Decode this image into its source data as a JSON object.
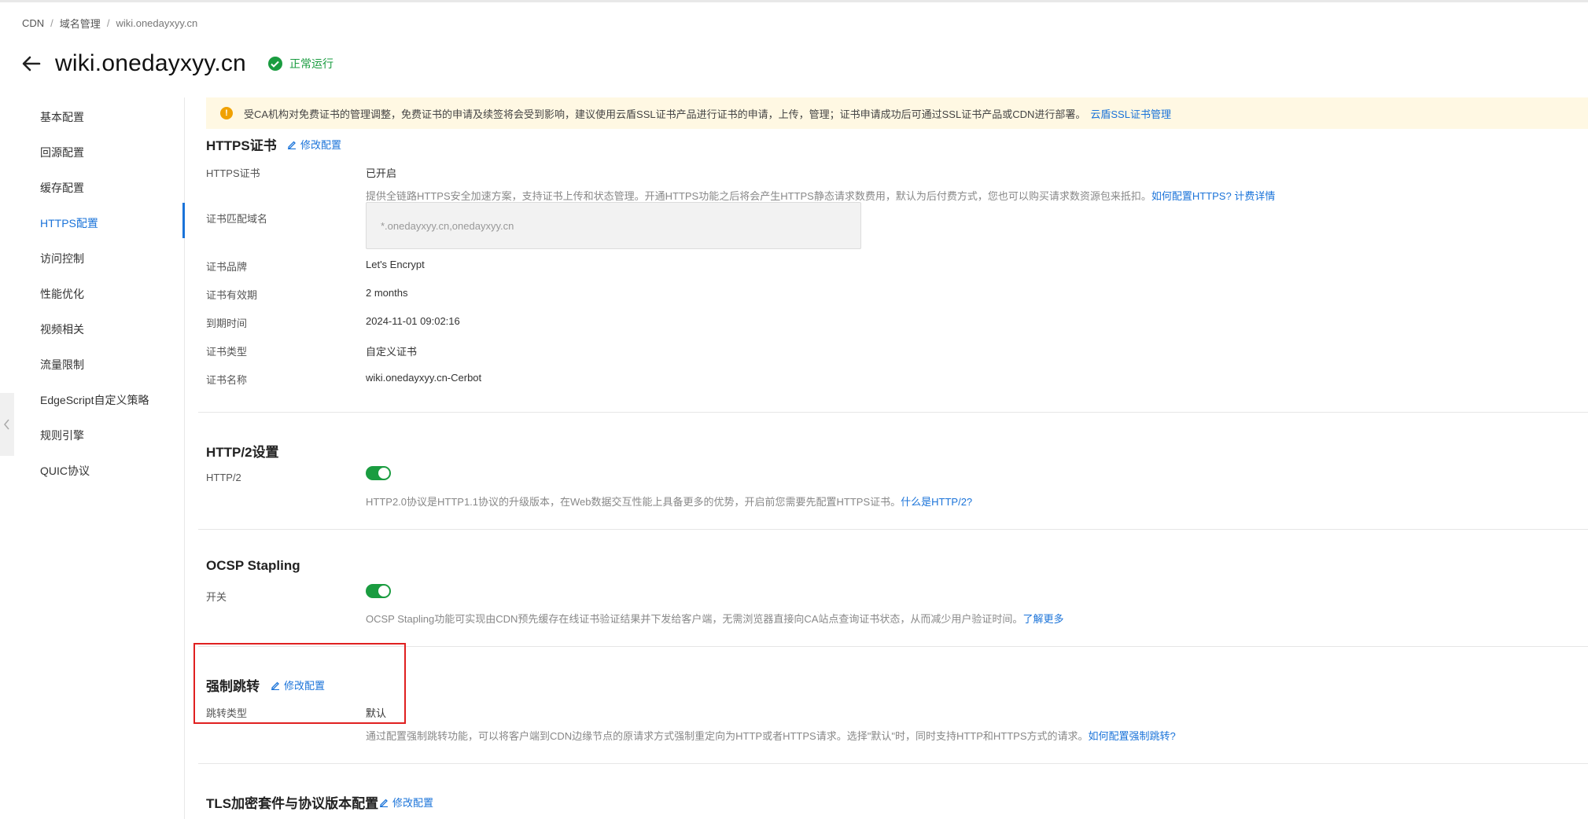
{
  "breadcrumb": {
    "items": [
      "CDN",
      "域名管理",
      "wiki.onedayxyy.cn"
    ],
    "separator": "/"
  },
  "header": {
    "title": "wiki.onedayxyy.cn",
    "status": "正常运行"
  },
  "sidebar": {
    "items": [
      {
        "label": "基本配置"
      },
      {
        "label": "回源配置"
      },
      {
        "label": "缓存配置"
      },
      {
        "label": "HTTPS配置"
      },
      {
        "label": "访问控制"
      },
      {
        "label": "性能优化"
      },
      {
        "label": "视频相关"
      },
      {
        "label": "流量限制"
      },
      {
        "label": "EdgeScript自定义策略"
      },
      {
        "label": "规则引擎"
      },
      {
        "label": "QUIC协议"
      }
    ],
    "active": "HTTPS配置"
  },
  "notice": {
    "text": "受CA机构对免费证书的管理调整，免费证书的申请及续签将会受到影响，建议使用云盾SSL证书产品进行证书的申请，上传，管理；证书申请成功后可通过SSL证书产品或CDN进行部署。",
    "link": "云盾SSL证书管理"
  },
  "https_section": {
    "title": "HTTPS证书",
    "edit_label": "修改配置",
    "cert_label": "HTTPS证书",
    "cert_value": "已开启",
    "cert_desc": "提供全链路HTTPS安全加速方案，支持证书上传和状态管理。开通HTTPS功能之后将会产生HTTPS静态请求数费用，默认为后付费方式，您也可以购买请求数资源包来抵扣。",
    "cert_link_1": "如何配置HTTPS?",
    "cert_link_2": "计费详情",
    "domain_label": "证书匹配域名",
    "domain_value": "*.onedayxyy.cn,onedayxyy.cn",
    "brand_label": "证书品牌",
    "brand_value": "Let's Encrypt",
    "validity_label": "证书有效期",
    "validity_value": "2 months",
    "expire_label": "到期时间",
    "expire_value": "2024-11-01 09:02:16",
    "type_label": "证书类型",
    "type_value": "自定义证书",
    "name_label": "证书名称",
    "name_value": "wiki.onedayxyy.cn-Cerbot"
  },
  "http2_section": {
    "title": "HTTP/2设置",
    "label": "HTTP/2",
    "enabled": true,
    "desc": "HTTP2.0协议是HTTP1.1协议的升级版本，在Web数据交互性能上具备更多的优势，开启前您需要先配置HTTPS证书。",
    "link": "什么是HTTP/2?"
  },
  "ocsp_section": {
    "title": "OCSP Stapling",
    "label": "开关",
    "enabled": true,
    "desc": "OCSP Stapling功能可实现由CDN预先缓存在线证书验证结果并下发给客户端，无需浏览器直接向CA站点查询证书状态，从而减少用户验证时间。",
    "link": "了解更多"
  },
  "redirect_section": {
    "title": "强制跳转",
    "edit_label": "修改配置",
    "label": "跳转类型",
    "value": "默认",
    "desc": "通过配置强制跳转功能，可以将客户端到CDN边缘节点的原请求方式强制重定向为HTTP或者HTTPS请求。选择\"默认\"时，同时支持HTTP和HTTPS方式的请求。",
    "link": "如何配置强制跳转?"
  },
  "tls_section": {
    "title": "TLS加密套件与协议版本配置",
    "edit_label": "修改配置"
  },
  "colors": {
    "accent": "#1a73d9",
    "success": "#1a9c40",
    "warning_bg": "#fff8e3",
    "highlight": "#e02020"
  }
}
